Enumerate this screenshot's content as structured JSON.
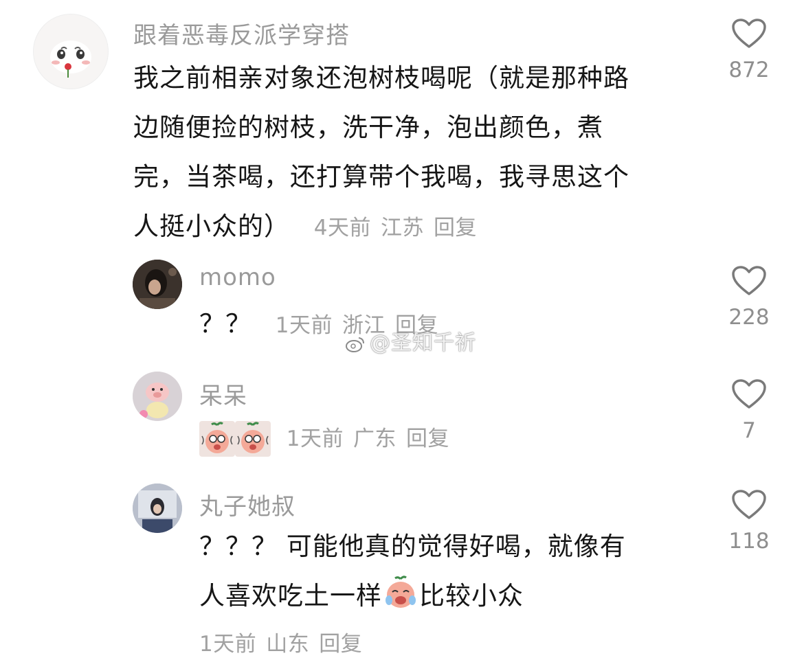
{
  "colors": {
    "text": "#161616",
    "muted": "#a1a1a1",
    "username": "#9a9a9a",
    "heart_stroke": "#7a7a7a"
  },
  "comments": [
    {
      "username": "跟着恶毒反派学穿搭",
      "avatar_icon": "cartoon-face-with-rose-avatar",
      "lines": [
        "我之前相亲对象还泡树枝喝呢（就是那种路",
        "边随便捡的树枝，洗干净，泡出颜色，煮",
        "完，当茶喝，还打算带个我喝，我寻思这个",
        "人挺小众的）"
      ],
      "time": "4天前",
      "location": "江苏",
      "reply_label": "回复",
      "likes": "872"
    },
    {
      "username": "momo",
      "avatar_icon": "dark-photo-avatar",
      "text": "？？",
      "time": "1天前",
      "location": "浙江",
      "reply_label": "回复",
      "likes": "228"
    },
    {
      "username": "呆呆",
      "avatar_icon": "pig-plush-avatar",
      "stickers": [
        "crying-peach-sticker",
        "crying-peach-sticker"
      ],
      "time": "1天前",
      "location": "广东",
      "reply_label": "回复",
      "likes": "7"
    },
    {
      "username": "丸子她叔",
      "avatar_icon": "girl-photo-avatar",
      "line1": "？？？ 可能他真的觉得好喝，就像有",
      "line2_before": "人喜欢吃土一样",
      "line2_after": "比较小众",
      "time": "1天前",
      "location": "山东",
      "reply_label": "回复",
      "likes": "118"
    }
  ],
  "watermark": "@圣知千祈"
}
